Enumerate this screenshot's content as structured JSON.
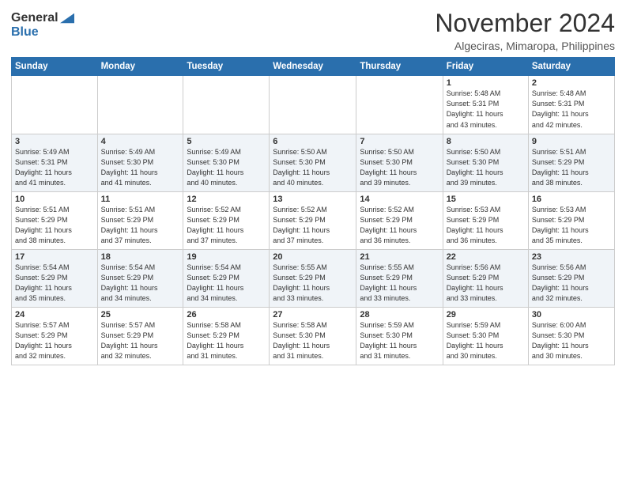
{
  "header": {
    "logo_general": "General",
    "logo_blue": "Blue",
    "month_title": "November 2024",
    "location": "Algeciras, Mimaropa, Philippines"
  },
  "weekdays": [
    "Sunday",
    "Monday",
    "Tuesday",
    "Wednesday",
    "Thursday",
    "Friday",
    "Saturday"
  ],
  "weeks": [
    [
      {
        "day": "",
        "info": ""
      },
      {
        "day": "",
        "info": ""
      },
      {
        "day": "",
        "info": ""
      },
      {
        "day": "",
        "info": ""
      },
      {
        "day": "",
        "info": ""
      },
      {
        "day": "1",
        "info": "Sunrise: 5:48 AM\nSunset: 5:31 PM\nDaylight: 11 hours\nand 43 minutes."
      },
      {
        "day": "2",
        "info": "Sunrise: 5:48 AM\nSunset: 5:31 PM\nDaylight: 11 hours\nand 42 minutes."
      }
    ],
    [
      {
        "day": "3",
        "info": "Sunrise: 5:49 AM\nSunset: 5:31 PM\nDaylight: 11 hours\nand 41 minutes."
      },
      {
        "day": "4",
        "info": "Sunrise: 5:49 AM\nSunset: 5:30 PM\nDaylight: 11 hours\nand 41 minutes."
      },
      {
        "day": "5",
        "info": "Sunrise: 5:49 AM\nSunset: 5:30 PM\nDaylight: 11 hours\nand 40 minutes."
      },
      {
        "day": "6",
        "info": "Sunrise: 5:50 AM\nSunset: 5:30 PM\nDaylight: 11 hours\nand 40 minutes."
      },
      {
        "day": "7",
        "info": "Sunrise: 5:50 AM\nSunset: 5:30 PM\nDaylight: 11 hours\nand 39 minutes."
      },
      {
        "day": "8",
        "info": "Sunrise: 5:50 AM\nSunset: 5:30 PM\nDaylight: 11 hours\nand 39 minutes."
      },
      {
        "day": "9",
        "info": "Sunrise: 5:51 AM\nSunset: 5:29 PM\nDaylight: 11 hours\nand 38 minutes."
      }
    ],
    [
      {
        "day": "10",
        "info": "Sunrise: 5:51 AM\nSunset: 5:29 PM\nDaylight: 11 hours\nand 38 minutes."
      },
      {
        "day": "11",
        "info": "Sunrise: 5:51 AM\nSunset: 5:29 PM\nDaylight: 11 hours\nand 37 minutes."
      },
      {
        "day": "12",
        "info": "Sunrise: 5:52 AM\nSunset: 5:29 PM\nDaylight: 11 hours\nand 37 minutes."
      },
      {
        "day": "13",
        "info": "Sunrise: 5:52 AM\nSunset: 5:29 PM\nDaylight: 11 hours\nand 37 minutes."
      },
      {
        "day": "14",
        "info": "Sunrise: 5:52 AM\nSunset: 5:29 PM\nDaylight: 11 hours\nand 36 minutes."
      },
      {
        "day": "15",
        "info": "Sunrise: 5:53 AM\nSunset: 5:29 PM\nDaylight: 11 hours\nand 36 minutes."
      },
      {
        "day": "16",
        "info": "Sunrise: 5:53 AM\nSunset: 5:29 PM\nDaylight: 11 hours\nand 35 minutes."
      }
    ],
    [
      {
        "day": "17",
        "info": "Sunrise: 5:54 AM\nSunset: 5:29 PM\nDaylight: 11 hours\nand 35 minutes."
      },
      {
        "day": "18",
        "info": "Sunrise: 5:54 AM\nSunset: 5:29 PM\nDaylight: 11 hours\nand 34 minutes."
      },
      {
        "day": "19",
        "info": "Sunrise: 5:54 AM\nSunset: 5:29 PM\nDaylight: 11 hours\nand 34 minutes."
      },
      {
        "day": "20",
        "info": "Sunrise: 5:55 AM\nSunset: 5:29 PM\nDaylight: 11 hours\nand 33 minutes."
      },
      {
        "day": "21",
        "info": "Sunrise: 5:55 AM\nSunset: 5:29 PM\nDaylight: 11 hours\nand 33 minutes."
      },
      {
        "day": "22",
        "info": "Sunrise: 5:56 AM\nSunset: 5:29 PM\nDaylight: 11 hours\nand 33 minutes."
      },
      {
        "day": "23",
        "info": "Sunrise: 5:56 AM\nSunset: 5:29 PM\nDaylight: 11 hours\nand 32 minutes."
      }
    ],
    [
      {
        "day": "24",
        "info": "Sunrise: 5:57 AM\nSunset: 5:29 PM\nDaylight: 11 hours\nand 32 minutes."
      },
      {
        "day": "25",
        "info": "Sunrise: 5:57 AM\nSunset: 5:29 PM\nDaylight: 11 hours\nand 32 minutes."
      },
      {
        "day": "26",
        "info": "Sunrise: 5:58 AM\nSunset: 5:29 PM\nDaylight: 11 hours\nand 31 minutes."
      },
      {
        "day": "27",
        "info": "Sunrise: 5:58 AM\nSunset: 5:30 PM\nDaylight: 11 hours\nand 31 minutes."
      },
      {
        "day": "28",
        "info": "Sunrise: 5:59 AM\nSunset: 5:30 PM\nDaylight: 11 hours\nand 31 minutes."
      },
      {
        "day": "29",
        "info": "Sunrise: 5:59 AM\nSunset: 5:30 PM\nDaylight: 11 hours\nand 30 minutes."
      },
      {
        "day": "30",
        "info": "Sunrise: 6:00 AM\nSunset: 5:30 PM\nDaylight: 11 hours\nand 30 minutes."
      }
    ]
  ]
}
